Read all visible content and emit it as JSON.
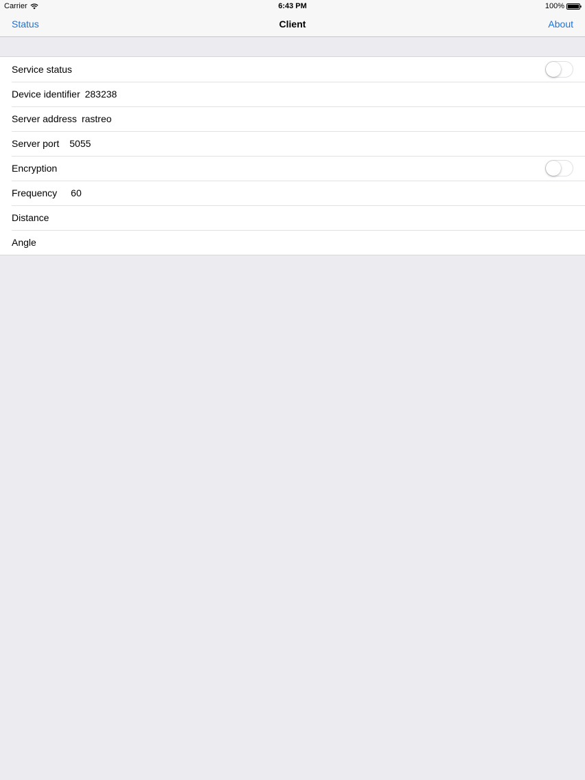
{
  "status_bar": {
    "carrier": "Carrier",
    "wifi_icon": "wifi-icon",
    "time": "6:43 PM",
    "battery_percent": "100%",
    "battery_icon": "battery-icon"
  },
  "nav": {
    "left_button": "Status",
    "title": "Client",
    "right_button": "About"
  },
  "colors": {
    "accent": "#1a73d9",
    "background": "#ebebf0",
    "toggle_off": "#ffffff"
  },
  "settings": {
    "service_status": {
      "label": "Service status",
      "enabled": false
    },
    "device_identifier": {
      "label": "Device identifier",
      "value": "283238"
    },
    "server_address": {
      "label": "Server address",
      "value": "rastreo"
    },
    "server_port": {
      "label": "Server port",
      "value": "5055"
    },
    "encryption": {
      "label": "Encryption",
      "enabled": false
    },
    "frequency": {
      "label": "Frequency",
      "value": "60"
    },
    "distance": {
      "label": "Distance",
      "value": ""
    },
    "angle": {
      "label": "Angle",
      "value": ""
    }
  }
}
